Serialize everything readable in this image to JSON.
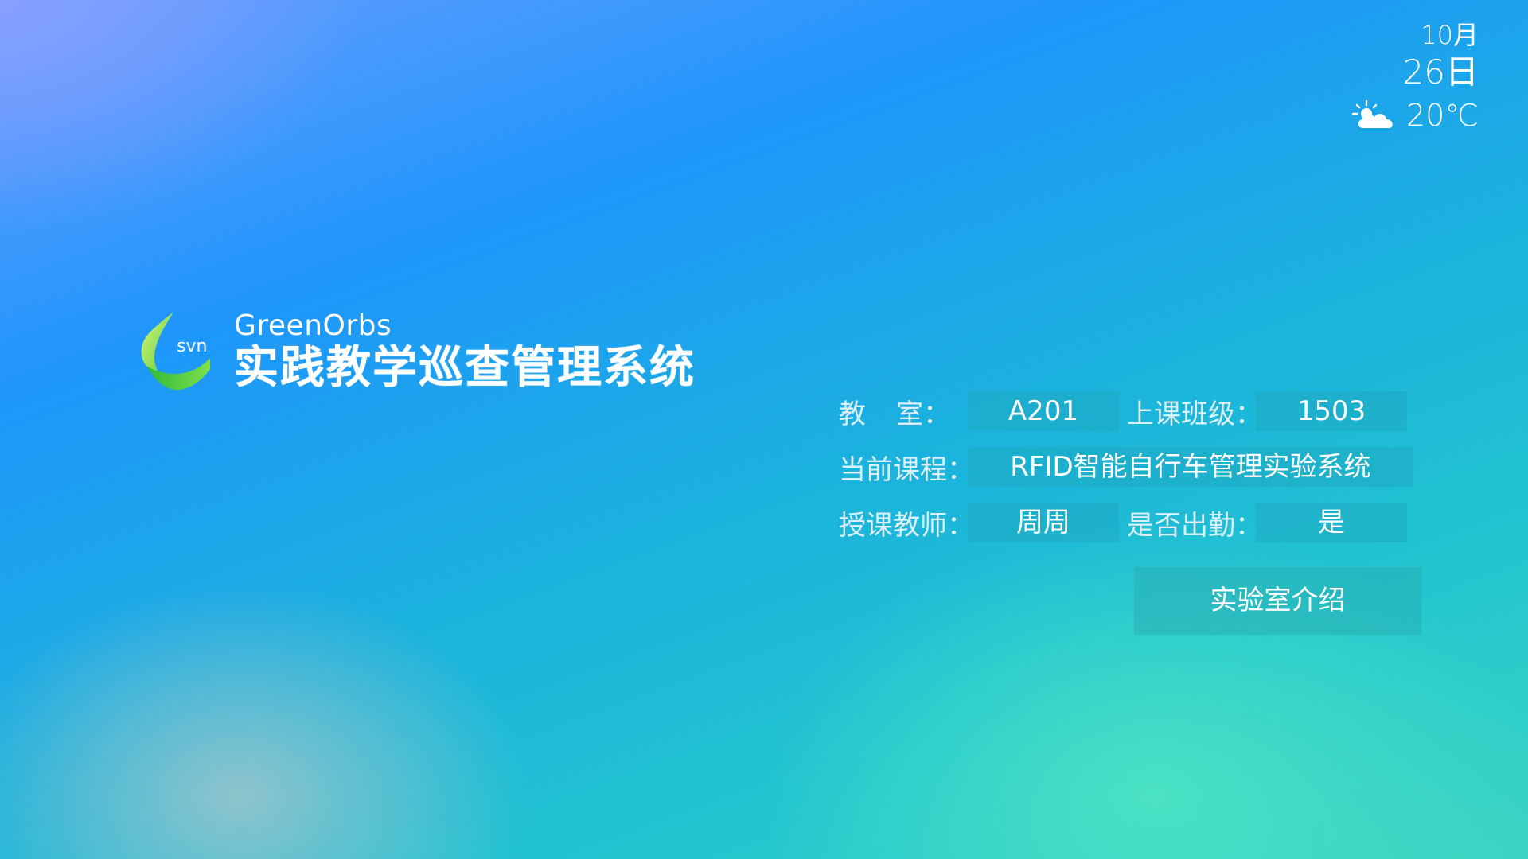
{
  "date": {
    "month": "10月",
    "day": "26日"
  },
  "weather": {
    "icon": "partly-cloudy-icon",
    "temperature": "20℃"
  },
  "brand": {
    "logo_text": "svn",
    "name": "GreenOrbs",
    "title": "实践教学巡查管理系统"
  },
  "info": {
    "classroom_label": [
      "教",
      "室："
    ],
    "classroom_value": "A201",
    "class_label": "上课班级：",
    "class_value": "1503",
    "course_label": "当前课程：",
    "course_value": "RFID智能自行车管理实验系统",
    "teacher_label": "授课教师：",
    "teacher_value": "周周",
    "attendance_label": "是否出勤：",
    "attendance_value": "是"
  },
  "actions": {
    "lab_intro_label": "实验室介绍"
  },
  "colors": {
    "logo_green_light": "#b8f06a",
    "logo_green_dark": "#2dbd3a"
  }
}
